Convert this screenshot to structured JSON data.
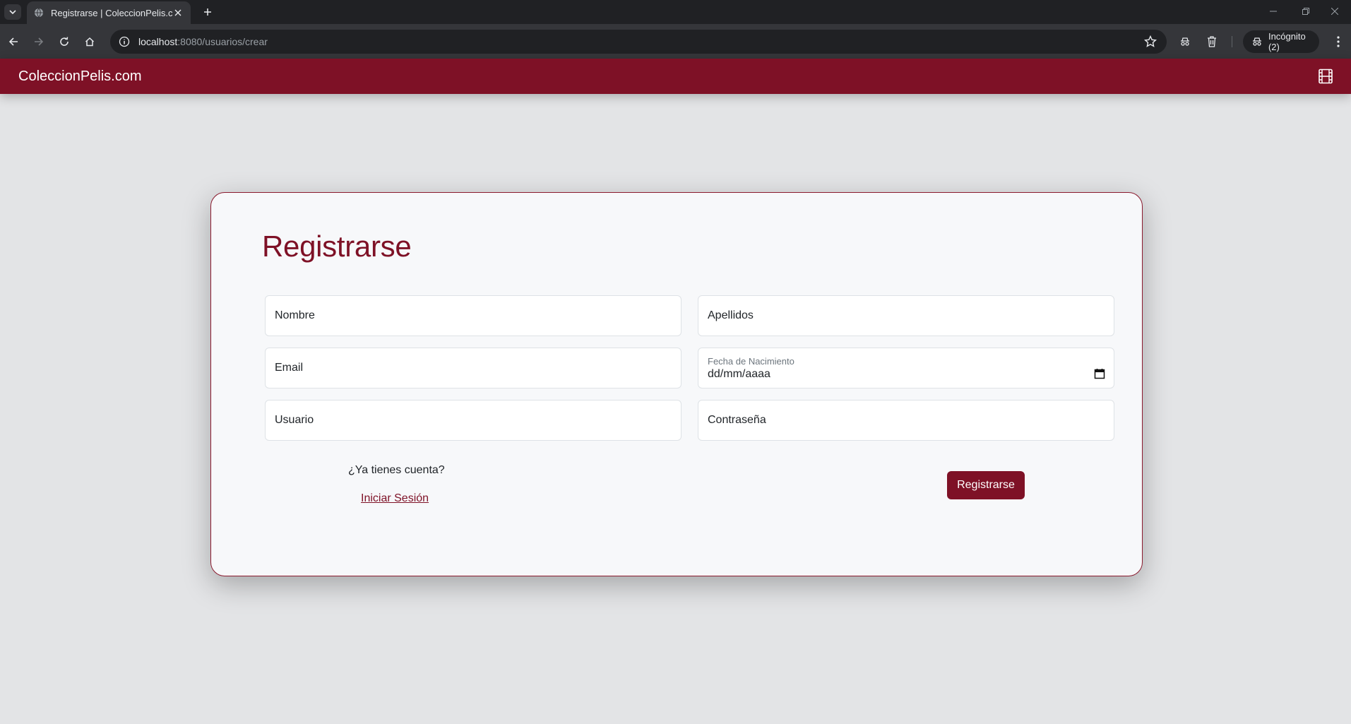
{
  "browser": {
    "tab_title": "Registrarse | ColeccionPelis.com",
    "url_host": "localhost",
    "url_path": ":8080/usuarios/crear",
    "incognito_label": "Incógnito (2)"
  },
  "navbar": {
    "brand": "ColeccionPelis.com",
    "icon": "film-icon",
    "color": "#7e1126"
  },
  "form": {
    "title": "Registrarse",
    "fields": {
      "nombre": {
        "placeholder": "Nombre"
      },
      "apellidos": {
        "placeholder": "Apellidos"
      },
      "email": {
        "placeholder": "Email"
      },
      "fecha": {
        "label": "Fecha de Nacimiento",
        "value": "dd/mm/aaaa"
      },
      "usuario": {
        "placeholder": "Usuario"
      },
      "contrasena": {
        "placeholder": "Contraseña"
      }
    },
    "account_prompt": "¿Ya tienes cuenta?",
    "login_link": "Iniciar Sesión",
    "submit_label": "Registrarse"
  }
}
